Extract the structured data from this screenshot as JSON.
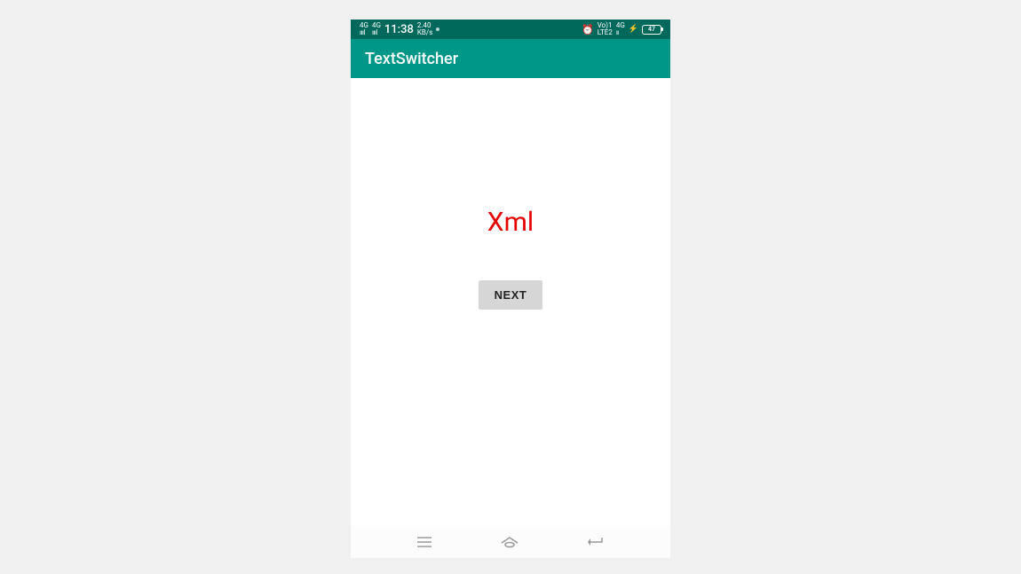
{
  "status": {
    "signal1": "4G",
    "signal2": "4G",
    "time": "11:38",
    "speed_val": "2.40",
    "speed_unit": "KB/s",
    "carrier1": "Vo)1",
    "carrier1b": "LTE2",
    "carrier2": "4G",
    "battery": "47"
  },
  "appbar": {
    "title": "TextSwitcher"
  },
  "main": {
    "switcher_text": "Xml",
    "button_label": "NEXT"
  }
}
